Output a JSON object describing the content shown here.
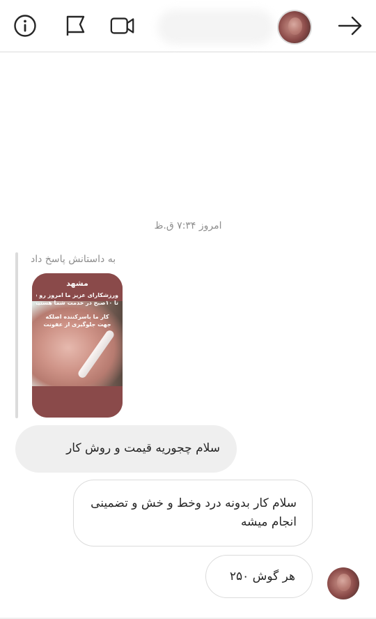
{
  "header": {
    "info_icon": "info-circle-icon",
    "flag_icon": "flag-icon",
    "video_icon": "video-camera-icon",
    "forward_icon": "arrow-right-icon",
    "avatar": "profile-photo"
  },
  "thread": {
    "timestamp": "امروز ۷:۳۴ ق.ظ",
    "reply_label": "به داستانش پاسخ داد",
    "story": {
      "title": "مشهد",
      "lines": [
        "ورزشکارای عزیز ما امروز رو فقط",
        "تا ۱۰صبح در خدمت شما هستیم",
        "کار ما باسرکننده اصلکه",
        "جهت جلوگیری از عفونت"
      ],
      "colors": {
        "frame": "#8a4a4a",
        "text": "#ffffff"
      }
    },
    "messages": [
      {
        "direction": "incoming",
        "text": "سلام چجوریه قیمت و روش کار"
      },
      {
        "direction": "outgoing",
        "text": "سلام کار بدونه درد وخط و خش و تضمینی انجام میشه"
      },
      {
        "direction": "outgoing",
        "text": "هر گوش ۲۵۰"
      }
    ]
  },
  "colors": {
    "incoming_bubble": "#efefef",
    "outgoing_border": "#dbdbdb",
    "meta_text": "#8e8e8e",
    "text": "#262626"
  }
}
